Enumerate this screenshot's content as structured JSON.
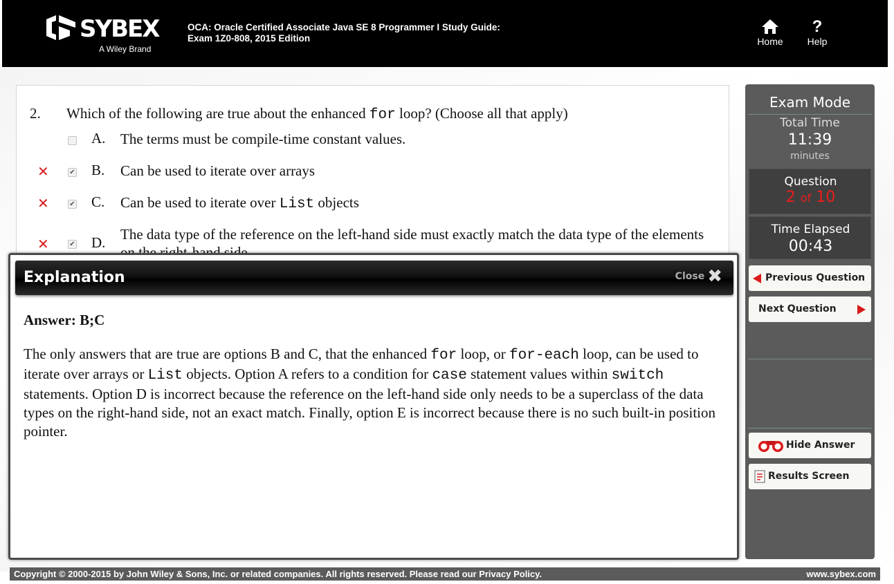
{
  "header": {
    "brand": "SYBEX",
    "brand_tagline": "A Wiley Brand",
    "book_title_line1": "OCA: Oracle Certified Associate Java SE 8 Programmer I Study Guide:",
    "book_title_line2": "Exam 1Z0-808, 2015 Edition",
    "home_label": "Home",
    "help_label": "Help",
    "home_icon": "home-icon",
    "help_icon": "question-mark-icon"
  },
  "question": {
    "number": "2.",
    "text_before": "Which of the following are true about the enhanced ",
    "text_code": "for",
    "text_after": " loop? (Choose all that apply)",
    "options": [
      {
        "letter": "A.",
        "text": "The terms must be compile-time constant values.",
        "checked": false,
        "marked_wrong": false
      },
      {
        "letter": "B.",
        "text": "Can be used to iterate over arrays",
        "checked": true,
        "marked_wrong": true
      },
      {
        "letter": "C.",
        "text_before": "Can be used to iterate over ",
        "text_code": "List",
        "text_after": " objects",
        "checked": true,
        "marked_wrong": true
      },
      {
        "letter": "D.",
        "text": "The data type of the reference on the left-hand side must exactly match the data type of the elements on the right-hand side",
        "checked": true,
        "marked_wrong": true
      }
    ],
    "wrong_mark": "✕",
    "check_mark": "✔"
  },
  "explanation": {
    "title": "Explanation",
    "close_label": "Close",
    "answer": "Answer: B;C",
    "body": [
      {
        "t": "The only answers that are true are options B and C, that the enhanced "
      },
      {
        "c": "for"
      },
      {
        "t": " loop, or "
      },
      {
        "c": "for-each"
      },
      {
        "t": " loop, can be used to iterate over arrays or "
      },
      {
        "c": "List"
      },
      {
        "t": " objects. Option A refers to a condition for "
      },
      {
        "c": "case"
      },
      {
        "t": " statement values within "
      },
      {
        "c": "switch"
      },
      {
        "t": " statements. Option D is incorrect because the reference on the left-hand side only needs to be a superclass of the data types on the right-hand side, not an exact match. Finally, option E is incorrect because there is no such built-in position pointer."
      }
    ]
  },
  "sidebar": {
    "mode_title": "Exam Mode",
    "total_time_label": "Total Time",
    "total_time_value": "11:39",
    "total_time_unit": "minutes",
    "question_label": "Question",
    "question_current": "2",
    "question_of": "of",
    "question_total": "10",
    "elapsed_label": "Time Elapsed",
    "elapsed_value": "00:43",
    "prev_label": "Previous Question",
    "next_label": "Next Question",
    "hide_answer_label": "Hide Answer",
    "results_label": "Results Screen",
    "hide_answer_icon": "binoculars-icon",
    "results_icon": "results-document-icon"
  },
  "footer": {
    "copyright": "Copyright © 2000-2015 by John Wiley & Sons, Inc. or related companies. All rights reserved. Please read our Privacy Policy.",
    "site": "www.sybex.com"
  },
  "colors": {
    "accent_red": "#d91a1a",
    "sidebar_gray": "#5b5b5b",
    "header_black": "#000000"
  }
}
